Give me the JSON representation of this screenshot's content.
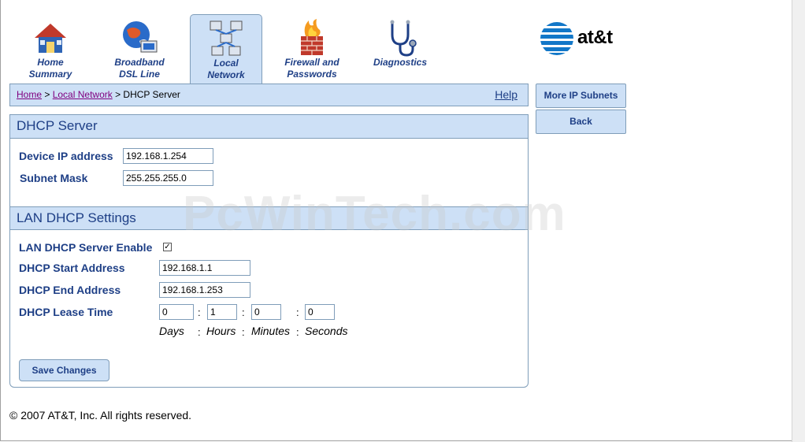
{
  "nav": {
    "tabs": [
      {
        "line1": "Home",
        "line2": "Summary"
      },
      {
        "line1": "Broadband",
        "line2": "DSL Line"
      },
      {
        "line1": "Local",
        "line2": "Network"
      },
      {
        "line1": "Firewall and",
        "line2": "Passwords"
      },
      {
        "line1": "Diagnostics",
        "line2": ""
      }
    ],
    "active_tab": "Local Network",
    "brand": "at&t"
  },
  "breadcrumb": {
    "home": "Home",
    "sep1": " > ",
    "local_network": "Local Network",
    "sep2": " > ",
    "current": "DHCP Server",
    "help": "Help"
  },
  "side": {
    "more_subnets": "More IP Subnets",
    "back": "Back"
  },
  "dhcp_server": {
    "title": "DHCP Server",
    "device_ip_label": "Device IP address",
    "device_ip_value": "192.168.1.254",
    "subnet_label": "Subnet Mask",
    "subnet_value": "255.255.255.0"
  },
  "lan_dhcp": {
    "title": "LAN DHCP Settings",
    "enable_label": "LAN DHCP Server Enable",
    "enable_mark": "✓",
    "start_label": "DHCP Start Address",
    "start_value": "192.168.1.1",
    "end_label": "DHCP End Address",
    "end_value": "192.168.1.253",
    "lease_label": "DHCP Lease Time",
    "lease_days": "0",
    "lease_hours": "1",
    "lease_minutes": "0",
    "lease_seconds": "0",
    "colon": ":",
    "unit_days": "Days",
    "unit_hours": "Hours",
    "unit_minutes": "Minutes",
    "unit_seconds": "Seconds",
    "save": "Save Changes"
  },
  "watermark": "PcWinTech.com",
  "footer": "© 2007 AT&T, Inc. All rights reserved.",
  "colors": {
    "accent_blue": "#1e3f86",
    "panel_blue": "#cde0f6",
    "border_blue": "#7f9db9"
  }
}
